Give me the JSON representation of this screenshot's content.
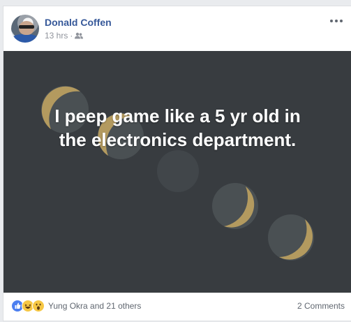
{
  "post": {
    "author": "Donald Coffen",
    "time": "13 hrs",
    "audience_icon": "friends-icon",
    "more_icon": "more-options-icon",
    "text_line1": "I peep game like a 5 yr old in",
    "text_line2": "the electronics department.",
    "background_color": "#383c40",
    "moon_gold": "#b39a5f",
    "moon_dark": "#4a5053"
  },
  "footer": {
    "reaction_icons": [
      "like-icon",
      "haha-icon",
      "wow-icon"
    ],
    "reactions_text": "Yung Okra and 21 others",
    "comments_text": "2 Comments"
  },
  "colors": {
    "author_blue": "#365899",
    "meta_gray": "#90949c",
    "page_bg": "#e9ebee"
  }
}
